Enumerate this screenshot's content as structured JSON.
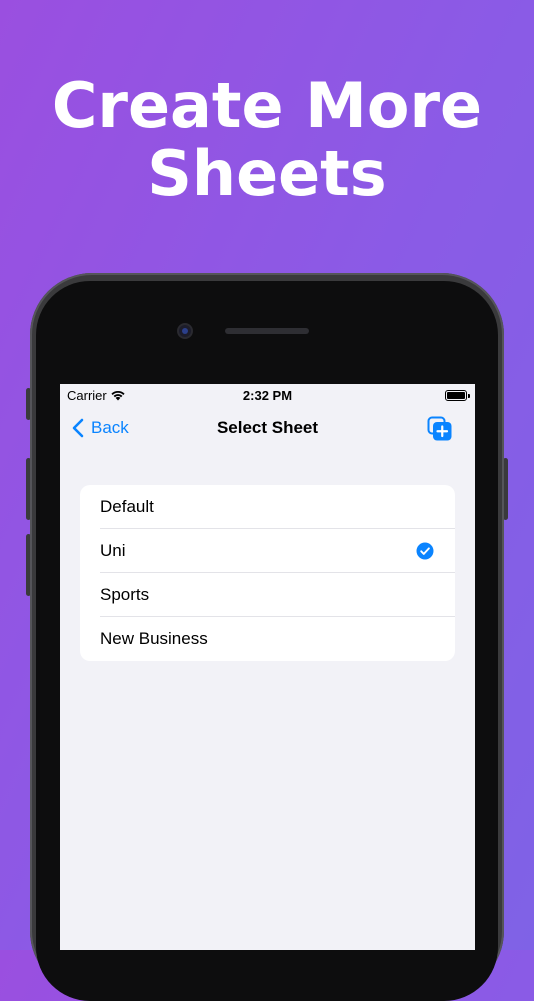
{
  "headline": {
    "line1": "Create More",
    "line2": "Sheets"
  },
  "status_bar": {
    "carrier": "Carrier",
    "time": "2:32 PM"
  },
  "nav": {
    "back_label": "Back",
    "title": "Select Sheet"
  },
  "sheets": [
    {
      "label": "Default",
      "selected": false
    },
    {
      "label": "Uni",
      "selected": true
    },
    {
      "label": "Sports",
      "selected": false
    },
    {
      "label": "New Business",
      "selected": false
    }
  ],
  "colors": {
    "accent": "#0a84ff",
    "background_top": "#9a4fe0",
    "background_bottom": "#7f62e6"
  },
  "icons": [
    "wifi-icon",
    "battery-icon",
    "chevron-left-icon",
    "add-sheet-icon",
    "checkmark-circle-icon"
  ]
}
